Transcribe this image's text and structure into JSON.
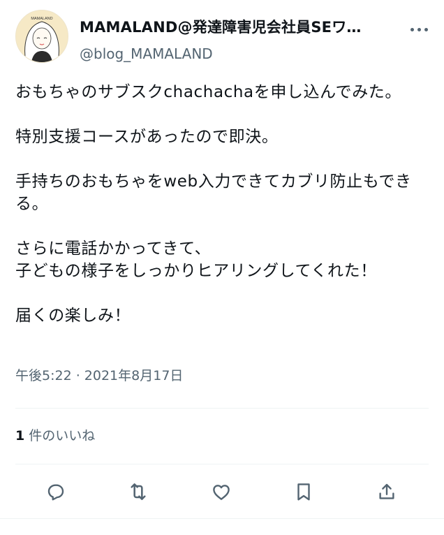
{
  "author": {
    "display_name": "MAMALAND@発達障害児会社員SEワ…",
    "handle": "@blog_MAMALAND",
    "avatar_text": "MAMALAND",
    "avatar_bg": "#f6e9c6"
  },
  "tweet": {
    "text": "おもちゃのサブスクchachachaを申し込んでみた。\n\n特別支援コースがあったので即決。\n\n手持ちのおもちゃをweb入力できてカブリ防止もできる。\n\nさらに電話かかってきて、\n子どもの様子をしっかりヒアリングしてくれた！\n\n届くの楽しみ！",
    "timestamp": "午後5:22 · 2021年8月17日"
  },
  "engagement": {
    "likes_count": "1",
    "likes_label": "件のいいね"
  },
  "actions": [
    {
      "name": "reply-icon"
    },
    {
      "name": "retweet-icon"
    },
    {
      "name": "like-icon"
    },
    {
      "name": "bookmark-icon"
    },
    {
      "name": "share-icon"
    }
  ],
  "colors": {
    "text_primary": "#0f1419",
    "text_secondary": "#536471",
    "divider": "#eff3f4",
    "icon": "#536471"
  }
}
